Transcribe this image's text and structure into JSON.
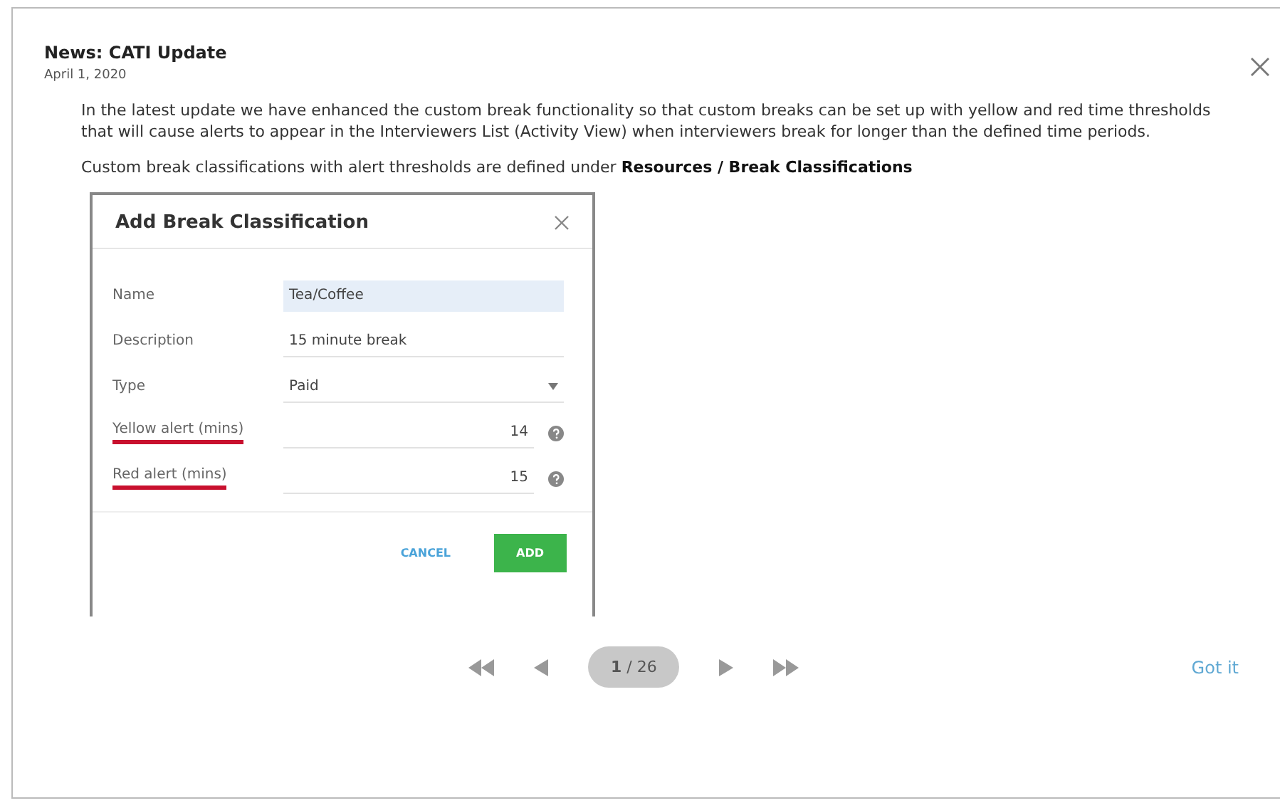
{
  "news": {
    "title": "News: CATI Update",
    "date": "April 1, 2020"
  },
  "paragraphs": [
    "In the latest update we have enhanced the custom break functionality so that custom breaks can be set up with yellow and red time thresholds that will cause alerts to appear in the Interviewers List (Activity View) when interviewers break for longer than the defined time periods.",
    "Custom break classifications with alert thresholds are defined under **Resources / Break Classifications**"
  ],
  "embedded_dialog": {
    "title": "Add Break Classification",
    "fields": [
      {
        "label": "Name",
        "value": "Tea/Coffee",
        "kind": "text",
        "focused": true,
        "underlined": false
      },
      {
        "label": "Description",
        "value": "15 minute break",
        "kind": "text",
        "focused": false,
        "underlined": false
      },
      {
        "label": "Type",
        "value": "Paid",
        "kind": "select",
        "focused": false,
        "underlined": false
      },
      {
        "label": "Yellow alert (mins)",
        "value": "14",
        "kind": "number",
        "focused": false,
        "underlined": true
      },
      {
        "label": "Red alert (mins)",
        "value": "15",
        "kind": "number",
        "focused": false,
        "underlined": true
      }
    ],
    "buttons": [
      {
        "label": "CANCEL",
        "kind": "flat"
      },
      {
        "label": "ADD",
        "kind": "primary"
      }
    ]
  },
  "pager": {
    "position": "**1** / 26"
  },
  "got_it": "Got it"
}
